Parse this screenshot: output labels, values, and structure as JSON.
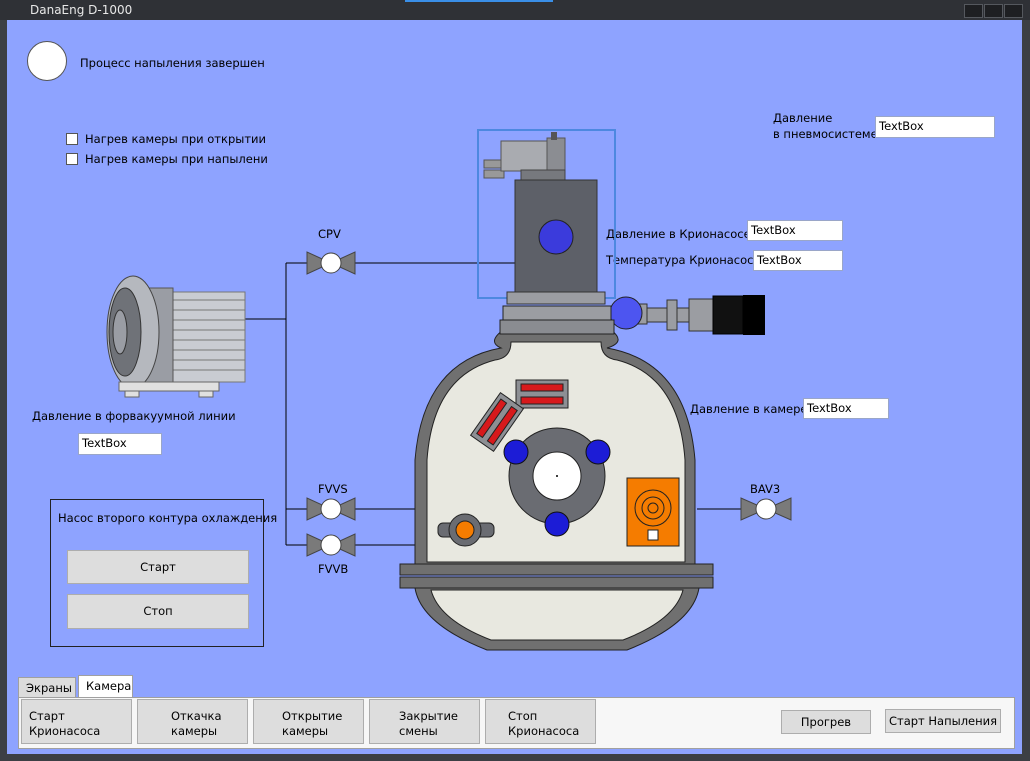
{
  "window": {
    "title": "DanaEng D-1000"
  },
  "status": {
    "label": "Процесс напыления завершен"
  },
  "options": [
    {
      "label": "Нагрев камеры при открытии",
      "checked": false
    },
    {
      "label": "Нагрев камеры при напылени",
      "checked": false
    }
  ],
  "pneumo": {
    "label_line1": "Давление",
    "label_line2": "в пневмосистеме",
    "value": "TextBox"
  },
  "cryo": {
    "pressure_label": "Давление в Крионасосе",
    "pressure_value": "TextBox",
    "temp_label": "Температура Крионасоса",
    "temp_value": "TextBox"
  },
  "chamber": {
    "pressure_label": "Давление в камере",
    "pressure_value": "TextBox"
  },
  "foreline": {
    "pressure_label": "Давление в форвакуумной линии",
    "pressure_value": "TextBox"
  },
  "valves": {
    "cpv": "CPV",
    "fvvs": "FVVS",
    "fvvb": "FVVB",
    "bav3": "BAV3"
  },
  "pump2": {
    "title": "Насос второго контура охлаждения",
    "start": "Старт",
    "stop": "Стоп"
  },
  "tabs": [
    {
      "label": "Экраны"
    },
    {
      "label": "Камера"
    }
  ],
  "toolbar": {
    "start_cryo": "Старт\nКрионасоса",
    "pumpdown": "Откачка\nкамеры",
    "open_chamber": "Открытие\nкамеры",
    "close_shift": "Закрытие\nсмены",
    "stop_cryo": "Стоп\nКрионасоса",
    "warmup": "Прогрев",
    "start_deposition": "Старт Напыления"
  },
  "colors": {
    "background": "#8ea3ff",
    "indicator_blue": "#3b3bdc",
    "indicator_orange": "#f57c00"
  }
}
